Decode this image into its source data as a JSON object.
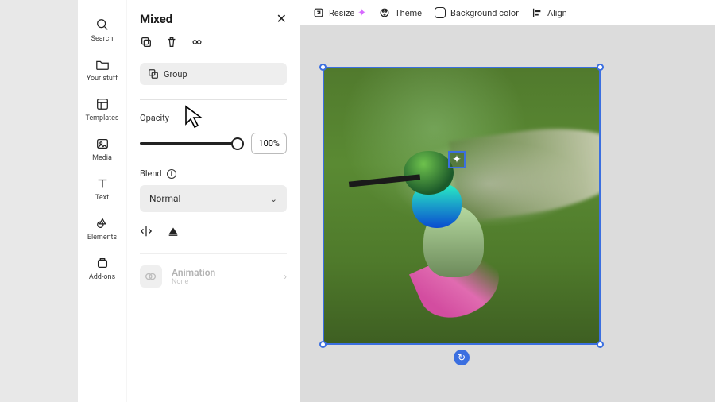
{
  "rail": {
    "items": [
      {
        "label": "Search"
      },
      {
        "label": "Your stuff"
      },
      {
        "label": "Templates"
      },
      {
        "label": "Media"
      },
      {
        "label": "Text"
      },
      {
        "label": "Elements"
      },
      {
        "label": "Add-ons"
      }
    ]
  },
  "panel": {
    "title": "Mixed",
    "group_label": "Group",
    "opacity_label": "Opacity",
    "opacity_value": "100%",
    "blend_label": "Blend",
    "blend_value": "Normal",
    "animation_label": "Animation",
    "animation_value": "None"
  },
  "toolbar": {
    "resize": "Resize",
    "theme": "Theme",
    "bgcolor": "Background color",
    "align": "Align"
  },
  "canvas": {
    "selection_color": "#3b6fe0"
  }
}
